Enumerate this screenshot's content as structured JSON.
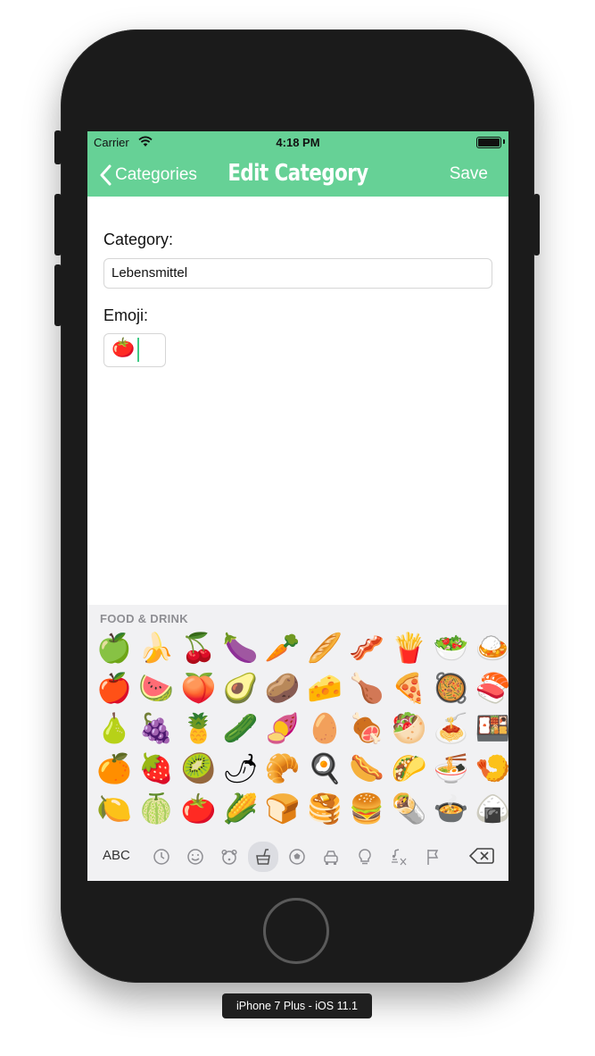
{
  "status_bar": {
    "carrier": "Carrier",
    "time": "4:18 PM"
  },
  "nav": {
    "back_label": "Categories",
    "title": "Edit Category",
    "save_label": "Save"
  },
  "form": {
    "category_label": "Category:",
    "category_value": "Lebensmittel",
    "emoji_label": "Emoji:",
    "emoji_value": "🍅"
  },
  "keyboard": {
    "section_title": "FOOD & DRINK",
    "emojis": [
      [
        "🍏",
        "🍌",
        "🍒",
        "🍆",
        "🥕",
        "🥖",
        "🥓",
        "🍟",
        "🥗",
        "🍛"
      ],
      [
        "🍎",
        "🍉",
        "🍑",
        "🥑",
        "🥔",
        "🧀",
        "🍗",
        "🍕",
        "🥘",
        "🍣"
      ],
      [
        "🍐",
        "🍇",
        "🍍",
        "🥒",
        "🍠",
        "🥚",
        "🍖",
        "🥙",
        "🍝",
        "🍱"
      ],
      [
        "🍊",
        "🍓",
        "🥝",
        "🌶",
        "🥐",
        "🍳",
        "🌭",
        "🌮",
        "🍜",
        "🍤"
      ],
      [
        "🍋",
        "🍈",
        "🍅",
        "🌽",
        "🍞",
        "🥞",
        "🍔",
        "🌯",
        "🍲",
        "🍙"
      ]
    ],
    "abc_label": "ABC",
    "categories": [
      "clock-icon",
      "smiley-icon",
      "animal-icon",
      "food-icon",
      "ball-icon",
      "car-icon",
      "lightbulb-icon",
      "symbols-icon",
      "flag-icon"
    ],
    "active_category": "food-icon"
  },
  "device_label": "iPhone 7 Plus - iOS 11.1",
  "colors": {
    "accent": "#66d196",
    "caret": "#3fca85",
    "keyboard_bg": "#f1f1f3"
  }
}
